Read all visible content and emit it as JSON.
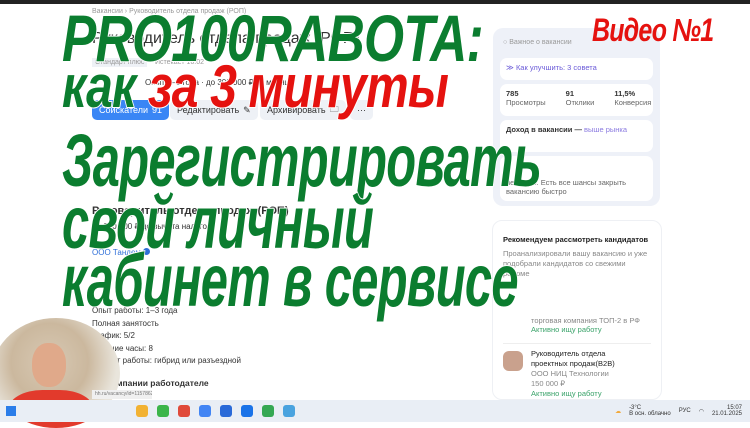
{
  "thumbnail": {
    "line1": "PRO100RABOTA:",
    "line2_green": "как",
    "line2_red": "за 3 минуты",
    "line3": "Зарегистрировать",
    "line4": "свой личный",
    "line5": "кабинет в сервисе",
    "badge": "Видео №1"
  },
  "page": {
    "breadcrumb": "Вакансии › Руководитель отдела продаж (РОП)",
    "title": "Руководитель отдела продаж (РОП)",
    "tariff": "Стандарт плюс",
    "expires": "Истекает 16.02",
    "meta": "Опыт 1–3 года · до 300 000 ₽ за месяц",
    "buttons": {
      "applicants": "Соискатели",
      "applicants_count": "91",
      "edit": "Редактировать",
      "archive": "Архивировать",
      "more": "···"
    },
    "section_title": "Руководитель отдела продаж (РОП)",
    "salary": "до 300 000 ₽ до вычета налогов",
    "company": "ООО Тандем",
    "details": [
      "Опыт работы: 1–3 года",
      "Полная занятость",
      "График: 5/2",
      "Рабочие часы: 8",
      "Формат работы: гибрид или разъездной"
    ],
    "about": "О компании работодателе",
    "url": "hh.ru/vacancy/id=115786255&hhtmFrom=vacancy"
  },
  "sidebar": {
    "important": "Важное о вакансии",
    "improve": "Как улучшить: 3 совета",
    "stats": [
      {
        "value": "785",
        "label": "Просмотры"
      },
      {
        "value": "91",
        "label": "Отклики"
      },
      {
        "value": "11,5%",
        "label": "Конверсия"
      }
    ],
    "income_title": "Доход в вакансии —",
    "income_tag": "выше рынка",
    "competition": "не очень. Есть все шансы закрыть вакансию быстро",
    "rec_title": "Рекомендуем рассмотреть кандидатов",
    "rec_desc": "Проанализировали вашу вакансию и уже подобрали кандидатов со свежими резюме",
    "cand1_company": "торговая компания ТОП-2 в РФ",
    "cand1_status": "Активно ищу работу",
    "cand2_title": "Руководитель отдела проектных продаж(B2B)",
    "cand2_company": "ООО НИЦ Технологии",
    "cand2_salary": "150 000 ₽",
    "cand2_status": "Активно ищу работу"
  },
  "taskbar": {
    "weather_temp": "-3°C",
    "weather_desc": "В осн. облачно",
    "lang": "РУС",
    "time": "15:07",
    "date": "21.01.2025"
  }
}
